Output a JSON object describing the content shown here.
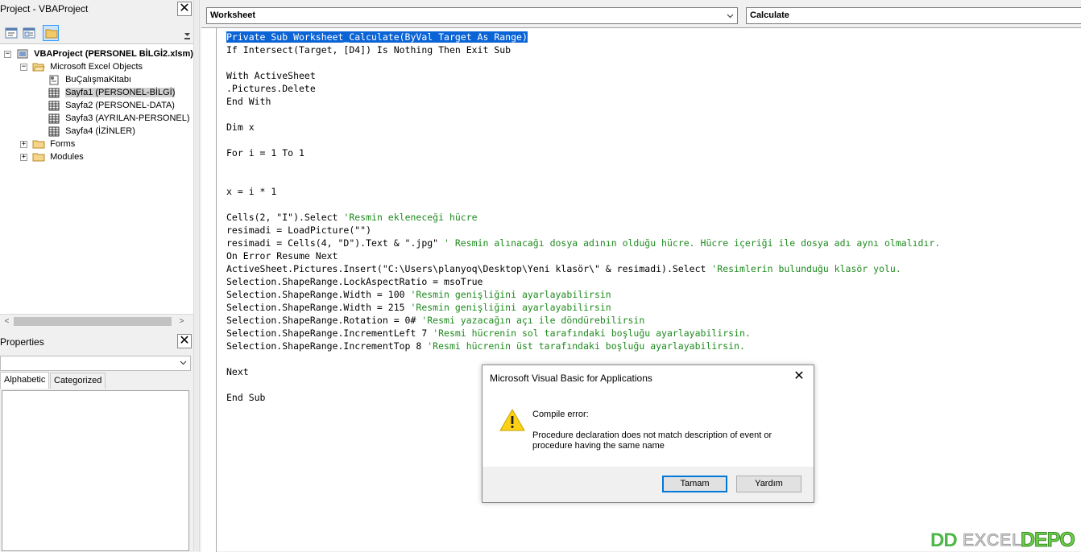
{
  "project_pane": {
    "title": "Project - VBAProject",
    "close_icon": "close-icon",
    "toolbar": [
      {
        "name": "view-code-button",
        "icon": "view-code-icon"
      },
      {
        "name": "view-object-button",
        "icon": "view-object-icon"
      },
      {
        "name": "toggle-folders-button",
        "icon": "folder-icon",
        "pressed": true
      }
    ],
    "tree": {
      "root": "VBAProject (PERSONEL BİLGİ2.xlsm)",
      "excel_objects": "Microsoft Excel Objects",
      "items": [
        "BuÇalışmaKitabı",
        "Sayfa1 (PERSONEL-BİLGİ)",
        "Sayfa2 (PERSONEL-DATA)",
        "Sayfa3 (AYRILAN-PERSONEL)",
        "Sayfa4 (İZİNLER)"
      ],
      "forms": "Forms",
      "modules": "Modules"
    }
  },
  "properties_pane": {
    "title": "Properties",
    "tabs": [
      "Alphabetic",
      "Categorized"
    ],
    "active_tab": "Alphabetic"
  },
  "code_window": {
    "object_select": "Worksheet",
    "procedure_select": "Calculate",
    "lines": [
      {
        "code": "Private Sub Worksheet_Calculate(ByVal Target As Range)",
        "comment": "",
        "selected": true
      },
      {
        "code": "If Intersect(Target, [D4]) Is Nothing Then Exit Sub",
        "comment": ""
      },
      {
        "code": "",
        "comment": ""
      },
      {
        "code": "With ActiveSheet",
        "comment": ""
      },
      {
        "code": ".Pictures.Delete",
        "comment": ""
      },
      {
        "code": "End With",
        "comment": ""
      },
      {
        "code": "",
        "comment": ""
      },
      {
        "code": "Dim x",
        "comment": ""
      },
      {
        "code": "",
        "comment": ""
      },
      {
        "code": "For i = 1 To 1",
        "comment": ""
      },
      {
        "code": "",
        "comment": ""
      },
      {
        "code": "",
        "comment": ""
      },
      {
        "code": "x = i * 1",
        "comment": ""
      },
      {
        "code": "",
        "comment": ""
      },
      {
        "code": "Cells(2, \"I\").Select ",
        "comment": "'Resmin ekleneceği hücre"
      },
      {
        "code": "resimadi = LoadPicture(\"\")",
        "comment": ""
      },
      {
        "code": "resimadi = Cells(4, \"D\").Text & \".jpg\" ",
        "comment": "' Resmin alınacağı dosya adının olduğu hücre. Hücre içeriği ile dosya adı aynı olmalıdır."
      },
      {
        "code": "On Error Resume Next",
        "comment": ""
      },
      {
        "code": "ActiveSheet.Pictures.Insert(\"C:\\Users\\planyoq\\Desktop\\Yeni klasör\\\" & resimadi).Select ",
        "comment": "'Resimlerin bulunduğu klasör yolu."
      },
      {
        "code": "Selection.ShapeRange.LockAspectRatio = msoTrue",
        "comment": ""
      },
      {
        "code": "Selection.ShapeRange.Width = 100 ",
        "comment": "'Resmin genişliğini ayarlayabilirsin"
      },
      {
        "code": "Selection.ShapeRange.Width = 215 ",
        "comment": "'Resmin genişliğini ayarlayabilirsin"
      },
      {
        "code": "Selection.ShapeRange.Rotation = 0# ",
        "comment": "'Resmi yazacağın açı ile döndürebilirsin"
      },
      {
        "code": "Selection.ShapeRange.IncrementLeft 7 ",
        "comment": "'Resmi hücrenin sol tarafındaki boşluğu ayarlayabilirsin."
      },
      {
        "code": "Selection.ShapeRange.IncrementTop 8 ",
        "comment": "'Resmi hücrenin üst tarafındaki boşluğu ayarlayabilirsin."
      },
      {
        "code": "",
        "comment": ""
      },
      {
        "code": "Next",
        "comment": ""
      },
      {
        "code": "",
        "comment": ""
      },
      {
        "code": "End Sub",
        "comment": ""
      }
    ]
  },
  "dialog": {
    "title": "Microsoft Visual Basic for Applications",
    "heading": "Compile error:",
    "message": "Procedure declaration does not match description of event or procedure having the same name",
    "ok_label": "Tamam",
    "help_label": "Yardım"
  },
  "watermark": {
    "left": "DD",
    "mid": "EXCEL",
    "right": "DEPO"
  },
  "colors": {
    "selection": "#0a64d6",
    "comment": "#1e8a1e",
    "watermark_green": "#4cb848"
  }
}
